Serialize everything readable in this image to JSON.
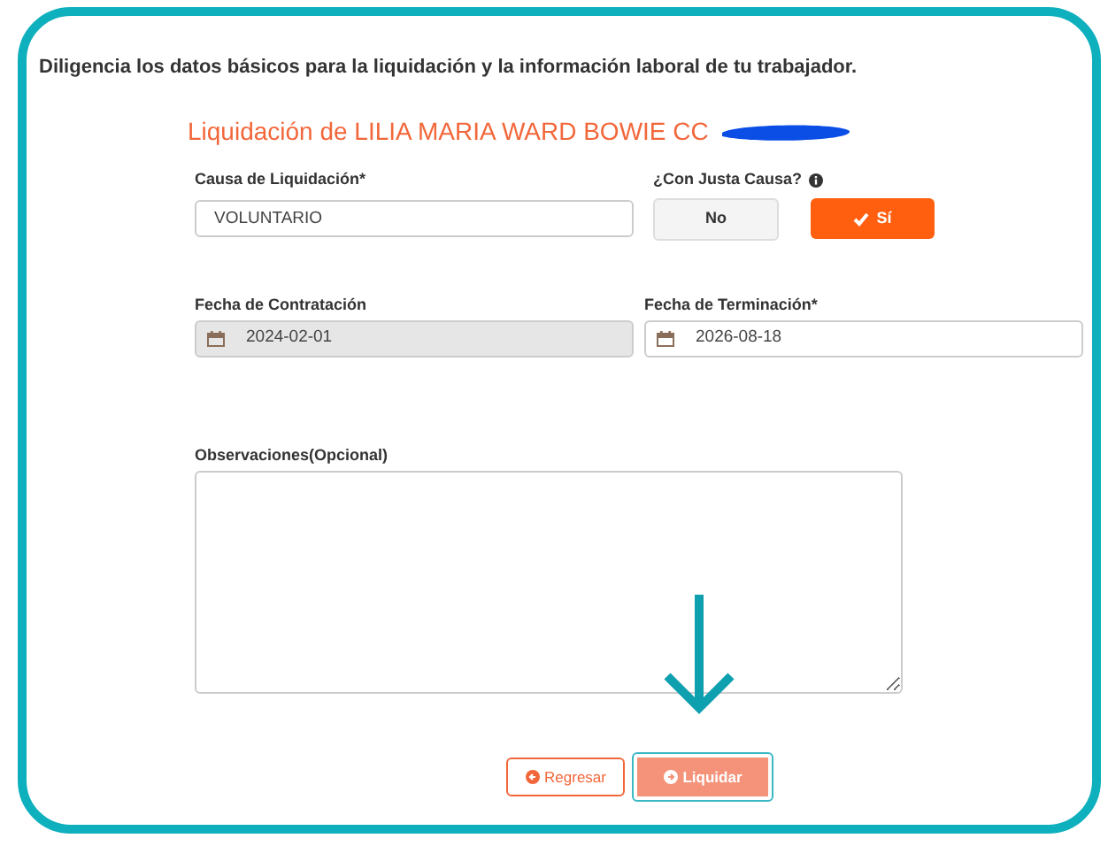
{
  "instructions": "Diligencia los datos básicos para la liquidación y la información laboral de tu trabajador.",
  "heading": "Liquidación de LILIA MARIA WARD BOWIE CC",
  "cause": {
    "label": "Causa de Liquidación*",
    "value": "VOLUNTARIO"
  },
  "just_cause": {
    "label": "¿Con Justa Causa?",
    "options": [
      {
        "label": "No",
        "selected": false
      },
      {
        "label": "Sí",
        "selected": true
      }
    ]
  },
  "hire_date": {
    "label": "Fecha de Contratación",
    "value": "2024-02-01",
    "disabled": true
  },
  "end_date": {
    "label": "Fecha de Terminación*",
    "value": "2026-08-18",
    "disabled": false
  },
  "notes": {
    "label": "Observaciones(Opcional)"
  },
  "buttons": [
    {
      "kind": "back",
      "label": "Regresar",
      "focused": false
    },
    {
      "kind": "submit",
      "label": "Liquidar",
      "focused": true
    }
  ]
}
